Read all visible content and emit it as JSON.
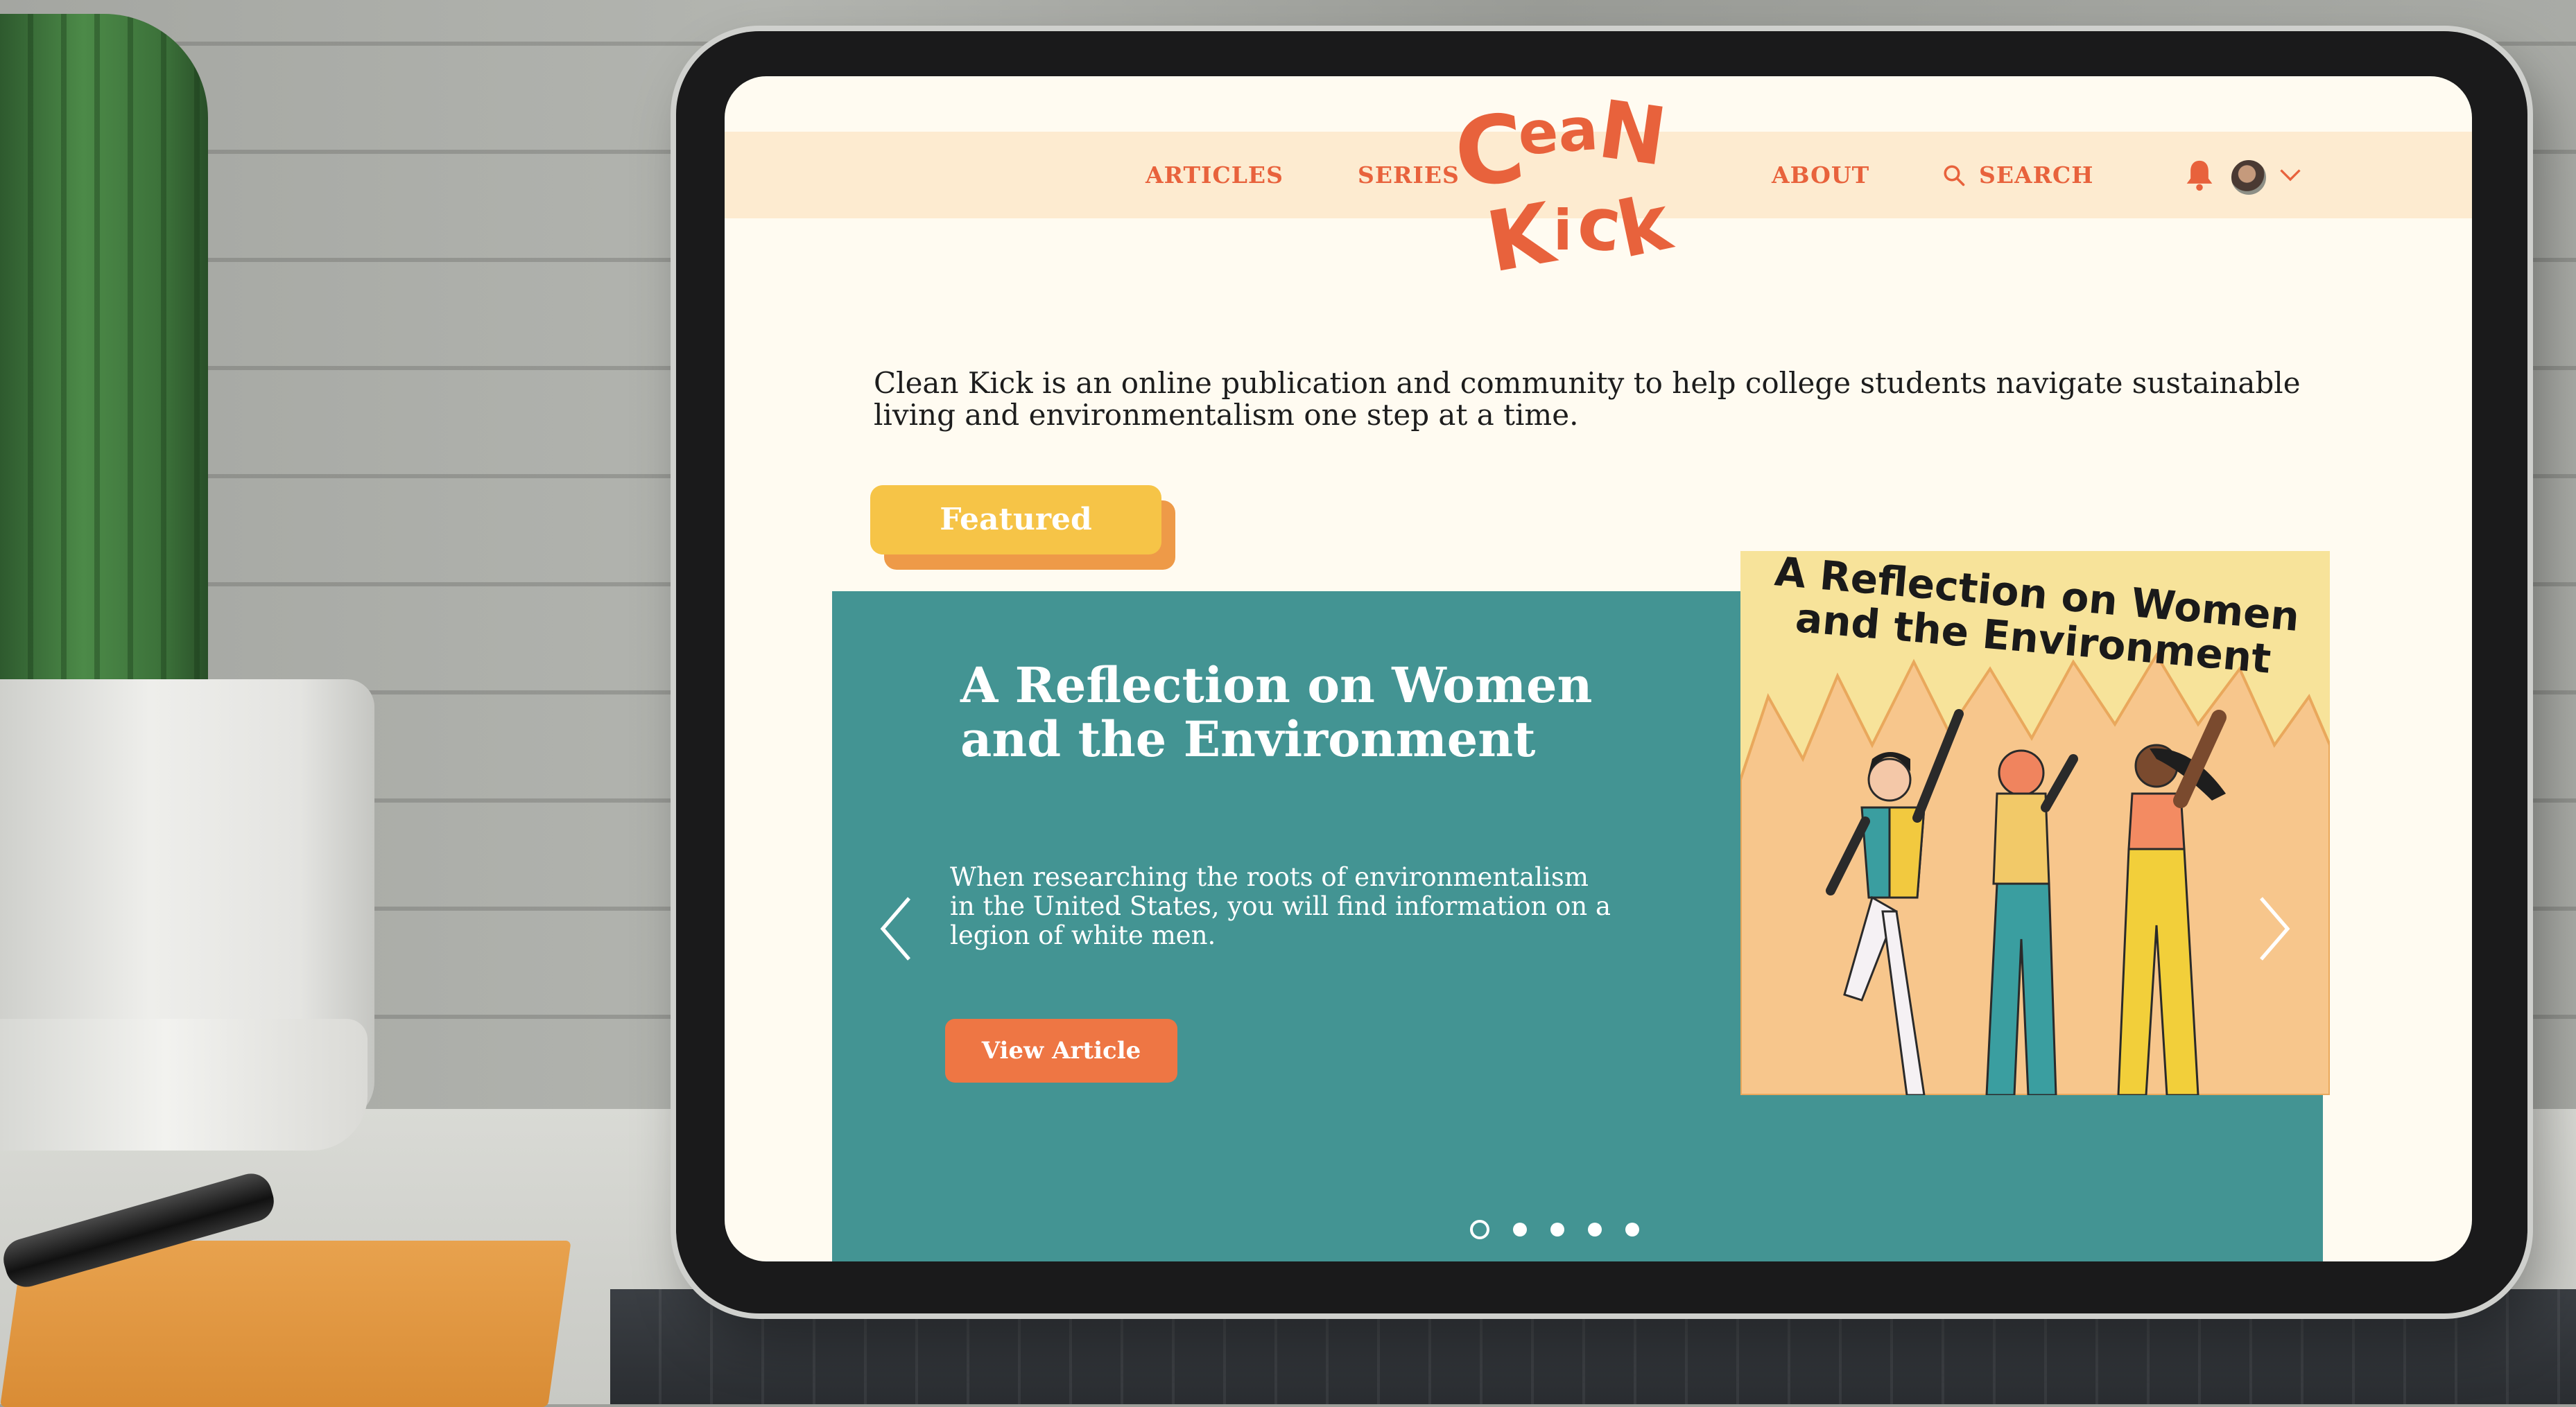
{
  "brand": {
    "logo_text": "Clean Kick",
    "colors": {
      "accent": "#e8623c",
      "teal": "#439493",
      "yellow": "#f6c447",
      "cream": "#fffbf1",
      "nav_bg": "#fdebd0"
    }
  },
  "nav": {
    "items": [
      {
        "label": "ARTICLES"
      },
      {
        "label": "SERIES"
      },
      {
        "label": "ABOUT"
      }
    ],
    "search_label": "SEARCH",
    "icons": {
      "search": "search-icon",
      "notifications": "bell-icon",
      "account": "avatar",
      "menu": "chevron-down-icon"
    }
  },
  "intro": {
    "text": "Clean Kick is an online publication and community to help college students navigate sustainable living and environmentalism one step at a time."
  },
  "featured": {
    "tag": "Featured",
    "slide": {
      "title": "A Reflection on Women and the Environment",
      "excerpt": "When researching the roots of environmentalism in the United States, you will find information on a legion of white men.",
      "cta": "View Article",
      "image_title": "A Reflection on Women and the Environment"
    },
    "slide_count": 5,
    "active_slide": 1
  }
}
